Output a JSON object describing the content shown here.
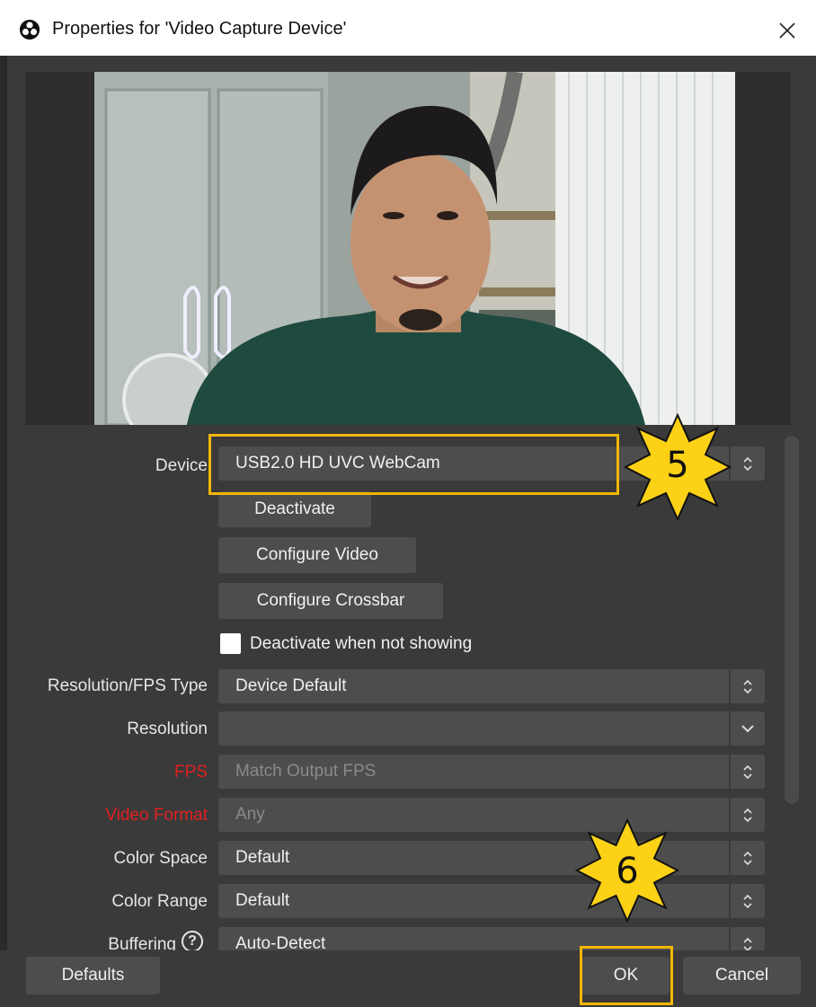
{
  "window": {
    "title": "Properties for 'Video Capture Device'",
    "icons": {
      "app": "obs-logo-icon",
      "close": "close-icon"
    }
  },
  "form": {
    "device": {
      "label": "Device",
      "value": "USB2.0 HD UVC WebCam"
    },
    "buttons": {
      "deactivate": "Deactivate",
      "configure_video": "Configure Video",
      "configure_crossbar": "Configure Crossbar"
    },
    "deactivate_when_not_showing": {
      "label": "Deactivate when not showing",
      "checked": false
    },
    "resolution_fps_type": {
      "label": "Resolution/FPS Type",
      "value": "Device Default"
    },
    "resolution": {
      "label": "Resolution",
      "value": ""
    },
    "fps": {
      "label": "FPS",
      "value": "Match Output FPS",
      "label_color": "#e02020"
    },
    "video_format": {
      "label": "Video Format",
      "value": "Any",
      "label_color": "#e02020"
    },
    "color_space": {
      "label": "Color Space",
      "value": "Default"
    },
    "color_range": {
      "label": "Color Range",
      "value": "Default"
    },
    "buffering": {
      "label": "Buffering",
      "value": "Auto-Detect",
      "help_icon": "?"
    }
  },
  "footer": {
    "defaults": "Defaults",
    "ok": "OK",
    "cancel": "Cancel"
  },
  "annotations": [
    {
      "number": "5",
      "target": "device-combo"
    },
    {
      "number": "6",
      "target": "ok-button"
    }
  ],
  "colors": {
    "highlight": "#f2b705",
    "badge_fill": "#fcd116",
    "window_bg": "#3a3a3a",
    "control_bg": "#4d4d4d"
  }
}
